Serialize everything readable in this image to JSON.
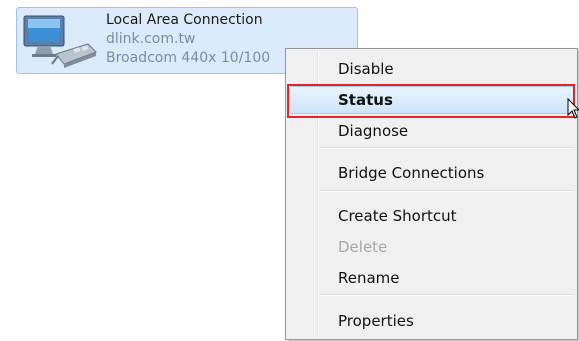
{
  "connection": {
    "name": "Local Area Connection",
    "network": "dlink.com.tw",
    "adapter": "Broadcom 440x 10/100",
    "icon": "network-adapter-icon"
  },
  "context_menu": {
    "items": [
      {
        "label": "Disable",
        "style": "normal"
      },
      {
        "label": "Status",
        "style": "bold",
        "hovered": true
      },
      {
        "label": "Diagnose",
        "style": "normal"
      },
      {
        "label": "Bridge Connections",
        "style": "normal"
      },
      {
        "label": "Create Shortcut",
        "style": "normal"
      },
      {
        "label": "Delete",
        "style": "disabled"
      },
      {
        "label": "Rename",
        "style": "normal"
      },
      {
        "label": "Properties",
        "style": "normal"
      }
    ]
  },
  "colors": {
    "selection_bg": "#dcebfb",
    "menu_bg": "#f0f0f0",
    "annotation_red": "#e1262b"
  }
}
